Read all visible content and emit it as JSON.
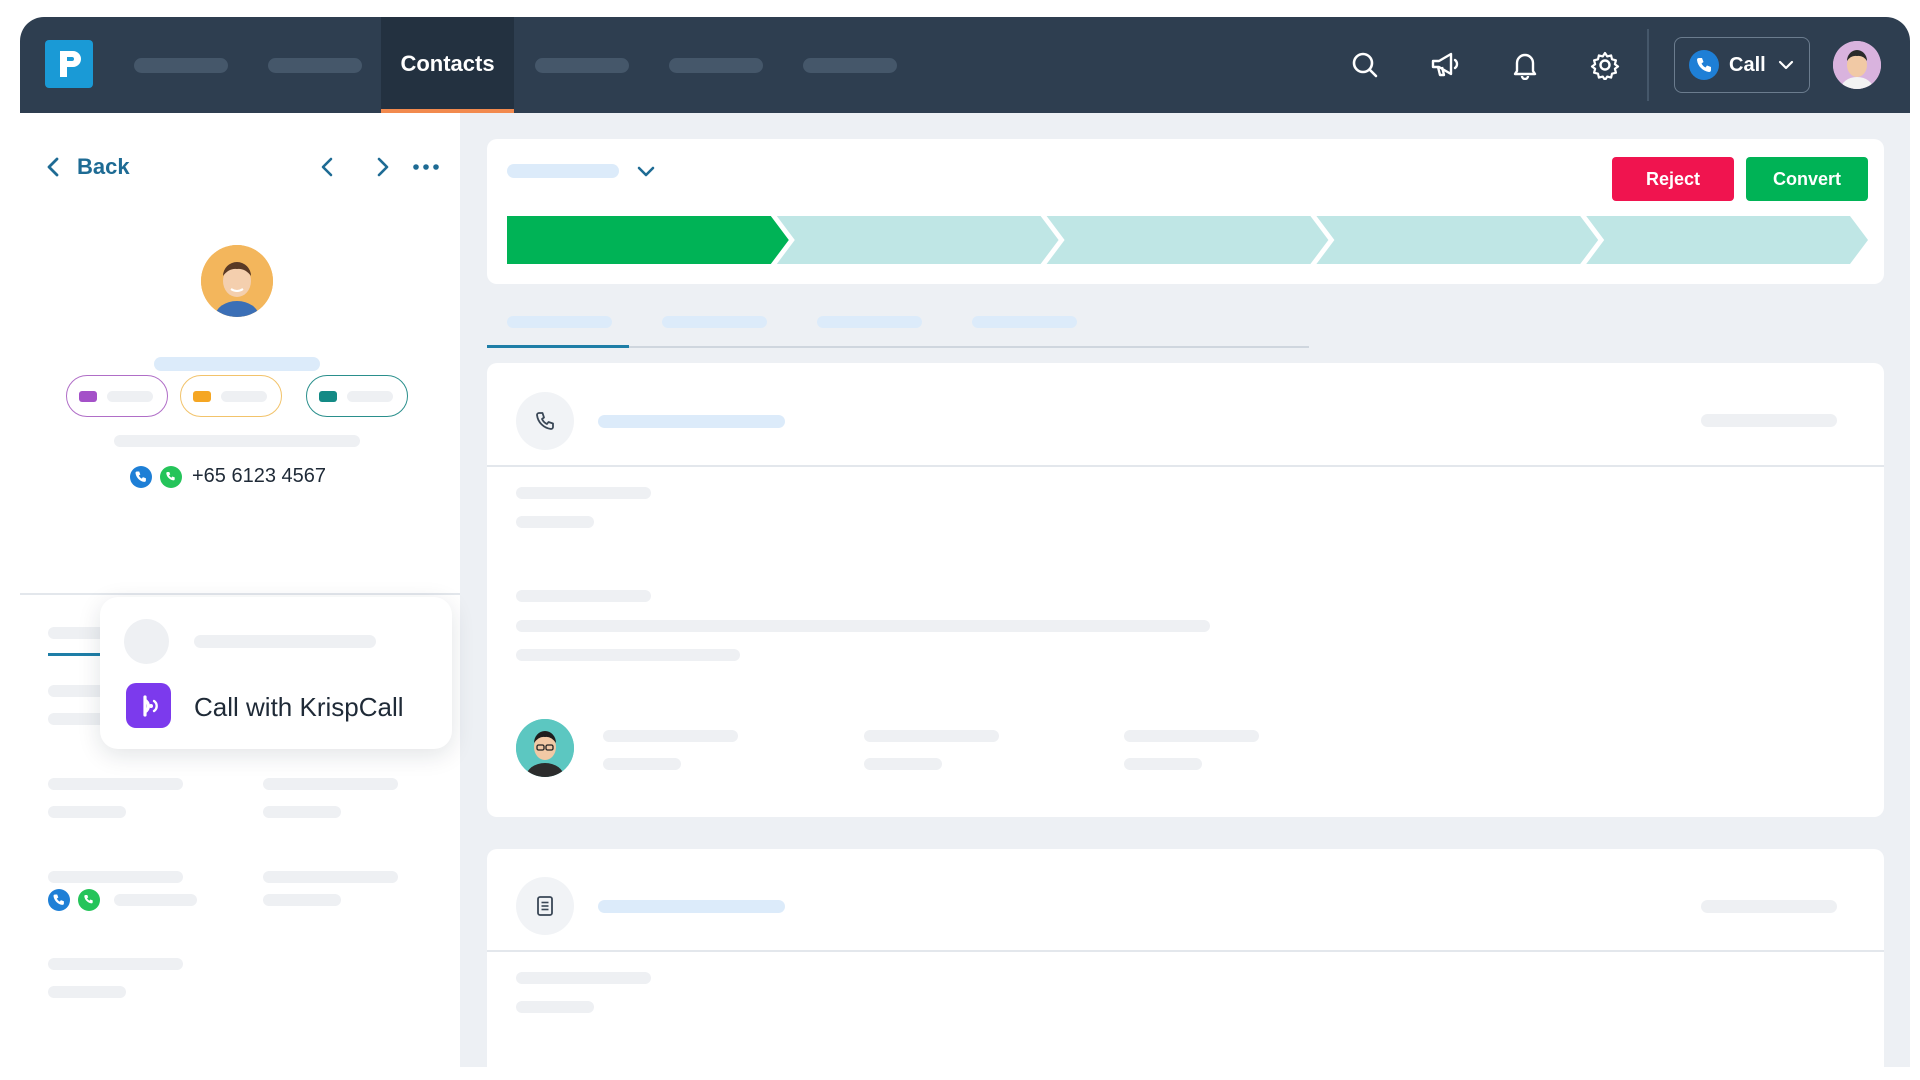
{
  "nav": {
    "active_tab": "Contacts",
    "call_button_label": "Call"
  },
  "contact": {
    "back_label": "Back",
    "phone": "+65 6123 4567"
  },
  "popup": {
    "call_with_label": "Call with KrispCall"
  },
  "deal": {
    "reject_label": "Reject",
    "convert_label": "Convert",
    "stages_total": 5,
    "stages_completed": 1
  },
  "colors": {
    "nav_bg": "#2e3e50",
    "accent_orange": "#f28a4e",
    "reject_red": "#f0144f",
    "convert_green": "#00b356",
    "stage_done": "#00b356",
    "stage_pending": "#bfe6e5",
    "krispcall_purple": "#7c3aed",
    "link_blue": "#1e6b94"
  }
}
